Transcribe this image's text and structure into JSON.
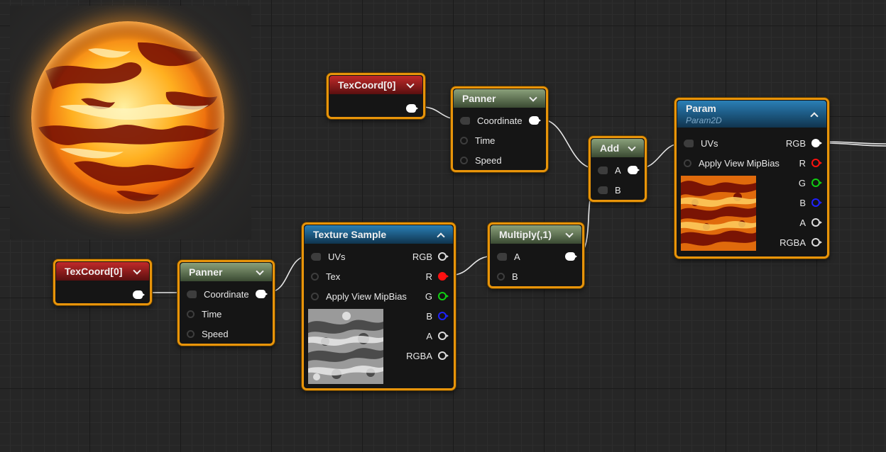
{
  "nodes": {
    "texcoord_top": {
      "title": "TexCoord[0]"
    },
    "panner_top": {
      "title": "Panner",
      "inputs": [
        "Coordinate",
        "Time",
        "Speed"
      ]
    },
    "add": {
      "title": "Add",
      "inputs": [
        "A",
        "B"
      ]
    },
    "param": {
      "title": "Param",
      "subtitle": "Param2D",
      "inputs": [
        "UVs",
        "Apply View MipBias"
      ],
      "outputs": [
        "RGB",
        "R",
        "G",
        "B",
        "A",
        "RGBA"
      ]
    },
    "texcoord_bottom": {
      "title": "TexCoord[0]"
    },
    "panner_bottom": {
      "title": "Panner",
      "inputs": [
        "Coordinate",
        "Time",
        "Speed"
      ]
    },
    "texture_sample": {
      "title": "Texture Sample",
      "inputs": [
        "UVs",
        "Tex",
        "Apply View MipBias"
      ],
      "outputs": [
        "RGB",
        "R",
        "G",
        "B",
        "A",
        "RGBA"
      ]
    },
    "multiply": {
      "title": "Multiply(,1)",
      "inputs": [
        "A",
        "B"
      ]
    }
  },
  "colors": {
    "node_border": "#e8940a",
    "header_red": "#c22a2a",
    "header_green": "#8aa07a",
    "header_blue": "#2a7fb6",
    "pin_red": "#ff1010",
    "pin_green": "#10d010",
    "pin_blue": "#2020ff"
  },
  "icons": {
    "collapse": "chevron-down-icon",
    "expand": "chevron-up-icon"
  }
}
